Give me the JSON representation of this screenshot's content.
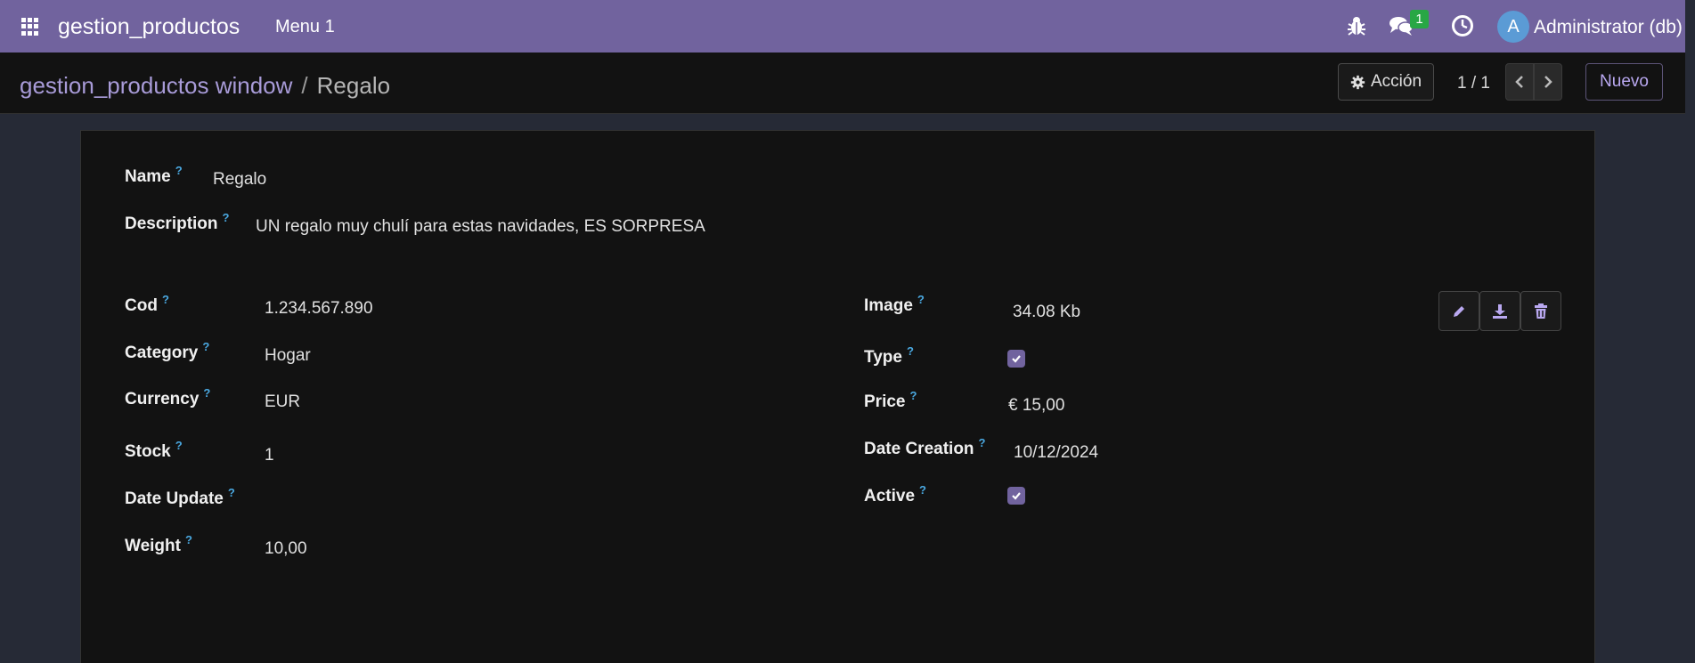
{
  "navbar": {
    "app_name": "gestion_productos",
    "menu_item": "Menu 1",
    "messages_count": "1",
    "user_initial": "A",
    "user_name": "Administrator (db)",
    "icons": [
      "apps-grid-icon",
      "bug-icon",
      "chat-icon",
      "clock-icon"
    ],
    "color": "#71639E"
  },
  "controlbar": {
    "breadcrumb_parent": "gestion_productos window",
    "breadcrumb_separator": "/",
    "breadcrumb_current": "Regalo",
    "action_label": "Acción",
    "pager_value": "1 / 1",
    "new_label": "Nuevo"
  },
  "form": {
    "help_mark": "?",
    "name": {
      "label": "Name",
      "value": "Regalo"
    },
    "description": {
      "label": "Description",
      "value": "UN regalo muy chulí para estas navidades, ES SORPRESA"
    },
    "cod": {
      "label": "Cod",
      "value": "1.234.567.890"
    },
    "category": {
      "label": "Category",
      "value": "Hogar"
    },
    "currency": {
      "label": "Currency",
      "value": "EUR"
    },
    "stock": {
      "label": "Stock",
      "value": "1"
    },
    "date_update": {
      "label": "Date Update",
      "value": ""
    },
    "weight": {
      "label": "Weight",
      "value": "10,00"
    },
    "image": {
      "label": "Image",
      "value": "34.08 Kb"
    },
    "type": {
      "label": "Type",
      "checked": true
    },
    "price": {
      "label": "Price",
      "value": "€ 15,00"
    },
    "date_creation": {
      "label": "Date Creation",
      "value": "10/12/2024"
    },
    "active": {
      "label": "Active",
      "checked": true
    }
  },
  "colors": {
    "accent": "#71639E",
    "link": "#A89BD8",
    "help": "#4AA8E0",
    "badge": "#28A745"
  }
}
